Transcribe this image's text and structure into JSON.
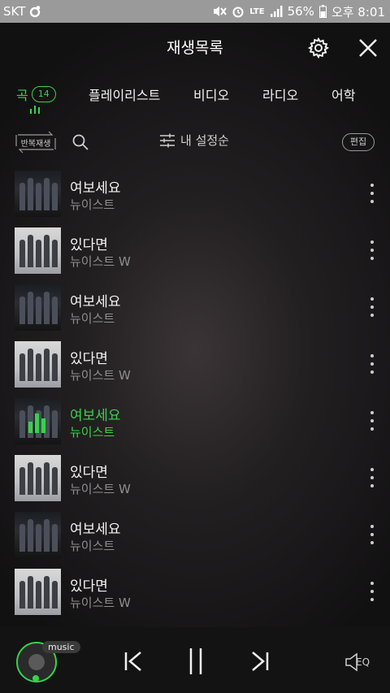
{
  "statusbar": {
    "carrier": "SKT",
    "network": "LTE",
    "battery": "56%",
    "time": "오후 8:01",
    "icons": [
      "mute-icon",
      "alarm-icon",
      "signal-icon",
      "battery-icon"
    ]
  },
  "header": {
    "title": "재생목록"
  },
  "tabs": {
    "song": {
      "label": "곡",
      "count": "14"
    },
    "playlist": "플레이리스트",
    "video": "비디오",
    "radio": "라디오",
    "language": "어학"
  },
  "toolbar": {
    "repeat_label": "반복재생",
    "sort_label": "내 설정순",
    "edit_label": "편집"
  },
  "songs": [
    {
      "title": "여보세요",
      "artist": "뉴이스트"
    },
    {
      "title": "있다면",
      "artist": "뉴이스트 W"
    },
    {
      "title": "여보세요",
      "artist": "뉴이스트"
    },
    {
      "title": "있다면",
      "artist": "뉴이스트 W"
    },
    {
      "title": "여보세요",
      "artist": "뉴이스트"
    },
    {
      "title": "있다면",
      "artist": "뉴이스트 W"
    },
    {
      "title": "여보세요",
      "artist": "뉴이스트"
    },
    {
      "title": "있다면",
      "artist": "뉴이스트 W"
    }
  ],
  "active_index": 4,
  "player": {
    "badge": "music",
    "eq_label": "EQ"
  },
  "colors": {
    "accent": "#38d24a",
    "statusbar": "#9a9a9a",
    "background": "#1e1c1e"
  }
}
